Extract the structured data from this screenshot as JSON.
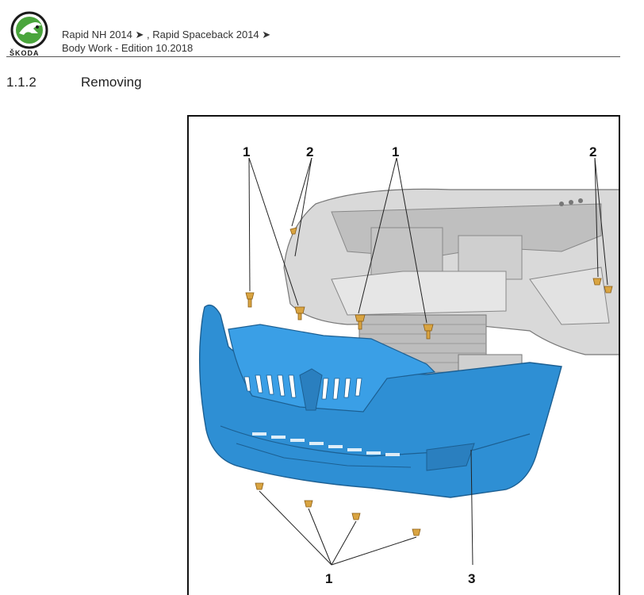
{
  "header": {
    "brand_wordmark": "ŠKODA",
    "line1": "Rapid NH 2014 ➤ , Rapid Spaceback 2014 ➤",
    "line2": "Body Work - Edition 10.2018"
  },
  "section": {
    "number": "1.1.2",
    "title": "Removing"
  },
  "figure": {
    "callouts": {
      "c1a": "1",
      "c2a": "2",
      "c1b": "1",
      "c2b": "2",
      "c1c": "1",
      "c3": "3"
    }
  },
  "colors": {
    "bumper": "#2e8fd4",
    "screw": "#d9a441",
    "logo_green": "#4aa53c"
  }
}
